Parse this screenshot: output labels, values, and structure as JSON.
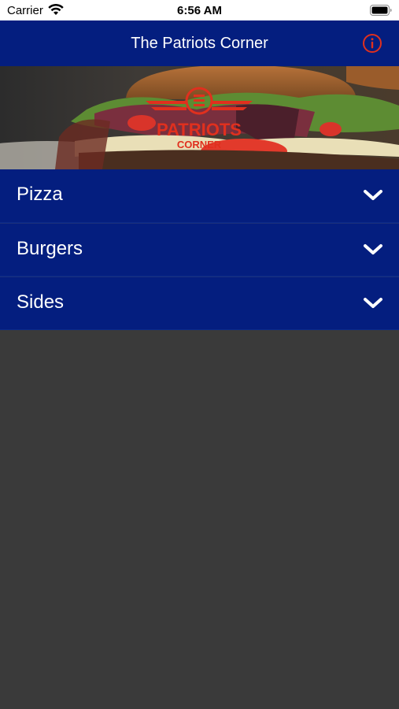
{
  "status_bar": {
    "carrier": "Carrier",
    "time": "6:56 AM"
  },
  "nav": {
    "title": "The Patriots Corner",
    "info_icon": "info-icon",
    "accent_color": "#e0301e"
  },
  "hero": {
    "image": "burger-photo",
    "logo_text": "PATRIOTS",
    "logo_subtext": "CORNER"
  },
  "menu": {
    "items": [
      {
        "label": "Pizza",
        "icon": "chevron-down-icon"
      },
      {
        "label": "Burgers",
        "icon": "chevron-down-icon"
      },
      {
        "label": "Sides",
        "icon": "chevron-down-icon"
      }
    ]
  },
  "colors": {
    "brand_blue": "#041e7f",
    "background": "#3a3a3a",
    "logo_red": "#e0301e"
  }
}
